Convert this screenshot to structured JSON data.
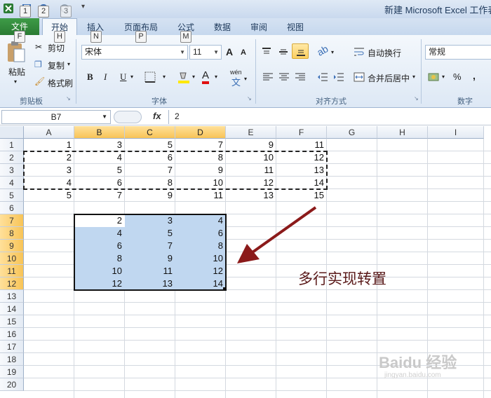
{
  "window": {
    "title": "新建 Microsoft Excel 工作表"
  },
  "keytips": {
    "q1": "1",
    "q2": "2",
    "q3": "3",
    "file": "F",
    "home": "H",
    "insert": "N",
    "layout": "P",
    "formula": "M"
  },
  "tabs": {
    "file": "文件",
    "home": "开始",
    "insert": "插入",
    "page_layout": "页面布局",
    "formulas": "公式",
    "data": "数据",
    "review": "审阅",
    "view": "视图"
  },
  "clipboard": {
    "paste": "粘贴",
    "cut": "剪切",
    "copy": "复制",
    "format_painter": "格式刷",
    "label": "剪贴板"
  },
  "font": {
    "name": "宋体",
    "size": "11",
    "label": "字体",
    "grow": "A",
    "shrink": "A",
    "bold": "B",
    "italic": "I",
    "underline": "U",
    "color_letter": "A",
    "wen": "wén"
  },
  "alignment": {
    "wrap": "自动换行",
    "merge": "合并后居中",
    "label": "对齐方式"
  },
  "number": {
    "format": "常规",
    "label": "数字",
    "percent": "%",
    "comma": ","
  },
  "formula_bar": {
    "name_box": "B7",
    "fx": "fx",
    "value": "2"
  },
  "columns": [
    "A",
    "B",
    "C",
    "D",
    "E",
    "F",
    "G",
    "H",
    "I"
  ],
  "rows": [
    "1",
    "2",
    "3",
    "4",
    "5",
    "6",
    "7",
    "8",
    "9",
    "10",
    "11",
    "12",
    "13",
    "14",
    "15",
    "16",
    "17",
    "18",
    "19",
    "20"
  ],
  "source_rows": [
    [
      "1",
      "3",
      "5",
      "7",
      "9",
      "11"
    ],
    [
      "2",
      "4",
      "6",
      "8",
      "10",
      "12"
    ],
    [
      "3",
      "5",
      "7",
      "9",
      "11",
      "13"
    ],
    [
      "4",
      "6",
      "8",
      "10",
      "12",
      "14"
    ],
    [
      "5",
      "7",
      "9",
      "11",
      "13",
      "15"
    ]
  ],
  "transposed_rows": [
    [
      "2",
      "3",
      "4"
    ],
    [
      "4",
      "5",
      "6"
    ],
    [
      "6",
      "7",
      "8"
    ],
    [
      "8",
      "9",
      "10"
    ],
    [
      "10",
      "11",
      "12"
    ],
    [
      "12",
      "13",
      "14"
    ]
  ],
  "annotation": "多行实现转置",
  "watermark": "Baidu 经验",
  "watermark_sub": "jingyan.baidu.com",
  "colors": {
    "selection": "#c0d7f0",
    "header_selected": "#f8c457",
    "file_tab": "#2a7b33",
    "arrow": "#8b1a1a"
  }
}
